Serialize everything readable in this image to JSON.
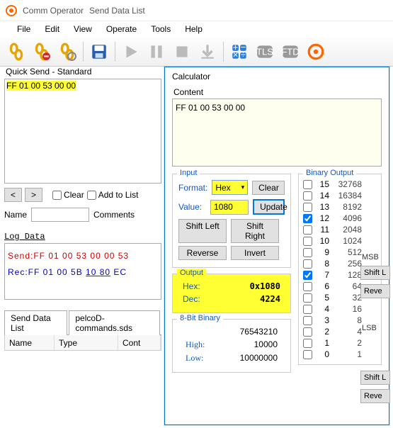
{
  "window": {
    "app": "Comm Operator",
    "doc": "Send Data List"
  },
  "menu": [
    "File",
    "Edit",
    "View",
    "Operate",
    "Tools",
    "Help"
  ],
  "quicksend": {
    "title": "Quick Send - Standard",
    "value": "FF 01 00 53 00 00",
    "prev": "<",
    "next": ">",
    "clear": "Clear",
    "addtolist": "Add to List",
    "name_label": "Name",
    "name_value": "",
    "comments_label": "Comments"
  },
  "log": {
    "title": "Log Data",
    "send": "Send:FF 01 00 53 00 00 53",
    "rec_pre": "Rec:FF 01 00 5B ",
    "rec_hl": "10 80",
    "rec_post": " EC"
  },
  "tabs": {
    "a": "Send Data List",
    "b": "pelcoD-commands.sds"
  },
  "gridcols": {
    "name": "Name",
    "type": "Type",
    "cont": "Cont"
  },
  "calc": {
    "title": "Calculator",
    "content_label": "Content",
    "content": "FF 01 00 53 00 00",
    "input_label": "Input",
    "format_label": "Format:",
    "format_value": "Hex",
    "value_label": "Value:",
    "value": "1080",
    "clear": "Clear",
    "update": "Update",
    "shift_left": "Shift Left",
    "shift_right": "Shift Right",
    "reverse": "Reverse",
    "invert": "Invert",
    "output_label": "Output",
    "hex_label": "Hex:",
    "hex_val": "0x1080",
    "dec_label": "Dec:",
    "dec_val": "4224",
    "eightbit_label": "8-Bit Binary",
    "eightbit_header": "76543210",
    "high_label": "High:",
    "high_val": "10000",
    "low_label": "Low:",
    "low_val": "10000000",
    "binout_label": "Binary Output",
    "bits": [
      {
        "n": "15",
        "v": "32768",
        "c": false
      },
      {
        "n": "14",
        "v": "16384",
        "c": false
      },
      {
        "n": "13",
        "v": "8192",
        "c": false
      },
      {
        "n": "12",
        "v": "4096",
        "c": true
      },
      {
        "n": "11",
        "v": "2048",
        "c": false
      },
      {
        "n": "10",
        "v": "1024",
        "c": false
      },
      {
        "n": "9",
        "v": "512",
        "c": false
      },
      {
        "n": "8",
        "v": "256",
        "c": false
      },
      {
        "n": "7",
        "v": "128",
        "c": true
      },
      {
        "n": "6",
        "v": "64",
        "c": false
      },
      {
        "n": "5",
        "v": "32",
        "c": false
      },
      {
        "n": "4",
        "v": "16",
        "c": false
      },
      {
        "n": "3",
        "v": "8",
        "c": false
      },
      {
        "n": "2",
        "v": "4",
        "c": false
      },
      {
        "n": "1",
        "v": "2",
        "c": false
      },
      {
        "n": "0",
        "v": "1",
        "c": false
      }
    ],
    "msb": "MSB",
    "lsb": "LSB",
    "side": {
      "shiftl": "Shift L",
      "reve1": "Reve",
      "shiftl2": "Shift L",
      "reve2": "Reve"
    }
  }
}
